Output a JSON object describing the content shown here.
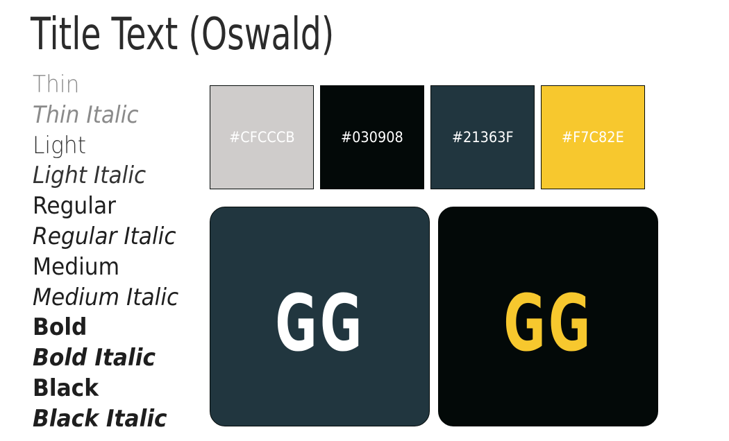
{
  "title": "Title Text (Oswald)",
  "weights": [
    "Thin",
    "Thin Italic",
    "Light",
    "Light Italic",
    "Regular",
    "Regular Italic",
    "Medium",
    "Medium Italic",
    "Bold",
    "Bold Italic",
    "Black",
    "Black Italic"
  ],
  "swatches": [
    {
      "label": "#CFCCCB",
      "color": "#CFCCCB"
    },
    {
      "label": "#030908",
      "color": "#030908"
    },
    {
      "label": "#21363F",
      "color": "#21363F"
    },
    {
      "label": "#F7C82E",
      "color": "#F7C82E"
    }
  ],
  "logos": [
    {
      "text": "GG",
      "background": "#21363F",
      "text_color": "#FFFFFF"
    },
    {
      "text": "GG",
      "background": "#030908",
      "text_color": "#F7C82E"
    }
  ]
}
